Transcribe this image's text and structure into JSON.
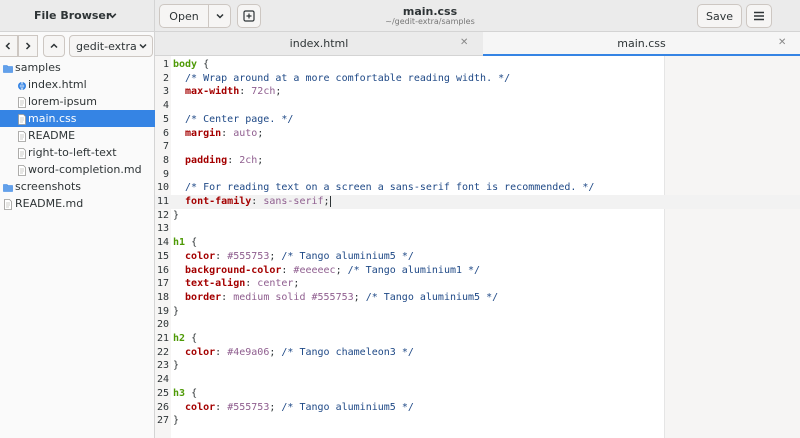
{
  "header": {
    "file_browser_title": "File Browser",
    "open_label": "Open",
    "window_title": "main.css",
    "window_subtitle": "~/gedit-extra/samples",
    "save_label": "Save"
  },
  "sidebar": {
    "folder_selector": "gedit-extra",
    "items": [
      {
        "label": "samples",
        "type": "folder",
        "indent": 0
      },
      {
        "label": "index.html",
        "type": "html-file",
        "indent": 1
      },
      {
        "label": "lorem-ipsum",
        "type": "text-file",
        "indent": 1
      },
      {
        "label": "main.css",
        "type": "css-file",
        "indent": 1,
        "selected": true
      },
      {
        "label": "README",
        "type": "text-file",
        "indent": 1
      },
      {
        "label": "right-to-left-text",
        "type": "text-file",
        "indent": 1
      },
      {
        "label": "word-completion.md",
        "type": "text-file",
        "indent": 1
      },
      {
        "label": "screenshots",
        "type": "folder",
        "indent": 0
      },
      {
        "label": "README.md",
        "type": "text-file",
        "indent": 0
      }
    ]
  },
  "tabs": [
    {
      "label": "index.html",
      "active": false
    },
    {
      "label": "main.css",
      "active": true
    }
  ],
  "editor": {
    "current_line": 11,
    "lines": [
      {
        "n": "1",
        "parts": [
          [
            "sel",
            "body"
          ],
          [
            "punc",
            " {"
          ]
        ]
      },
      {
        "n": "2",
        "parts": [
          [
            "cmt",
            "  /* Wrap around at a more comfortable reading width. */"
          ]
        ]
      },
      {
        "n": "3",
        "parts": [
          [
            "prop",
            "  max-width"
          ],
          [
            "punc",
            ": "
          ],
          [
            "val",
            "72ch"
          ],
          [
            "punc",
            ";"
          ]
        ]
      },
      {
        "n": "4",
        "parts": []
      },
      {
        "n": "5",
        "parts": [
          [
            "cmt",
            "  /* Center page. */"
          ]
        ]
      },
      {
        "n": "6",
        "parts": [
          [
            "prop",
            "  margin"
          ],
          [
            "punc",
            ": "
          ],
          [
            "val",
            "auto"
          ],
          [
            "punc",
            ";"
          ]
        ]
      },
      {
        "n": "7",
        "parts": []
      },
      {
        "n": "8",
        "parts": [
          [
            "prop",
            "  padding"
          ],
          [
            "punc",
            ": "
          ],
          [
            "val",
            "2ch"
          ],
          [
            "punc",
            ";"
          ]
        ]
      },
      {
        "n": "9",
        "parts": []
      },
      {
        "n": "10",
        "parts": [
          [
            "cmt",
            "  /* For reading text on a screen a sans-serif font is recommended. */"
          ]
        ]
      },
      {
        "n": "11",
        "parts": [
          [
            "prop",
            "  font-family"
          ],
          [
            "punc",
            ": "
          ],
          [
            "val",
            "sans-serif"
          ],
          [
            "punc",
            ";"
          ]
        ]
      },
      {
        "n": "12",
        "parts": [
          [
            "punc",
            "}"
          ]
        ]
      },
      {
        "n": "13",
        "parts": []
      },
      {
        "n": "14",
        "parts": [
          [
            "sel",
            "h1"
          ],
          [
            "punc",
            " {"
          ]
        ]
      },
      {
        "n": "15",
        "parts": [
          [
            "prop",
            "  color"
          ],
          [
            "punc",
            ": "
          ],
          [
            "val",
            "#555753"
          ],
          [
            "punc",
            "; "
          ],
          [
            "cmt",
            "/* Tango aluminium5 */"
          ]
        ]
      },
      {
        "n": "16",
        "parts": [
          [
            "prop",
            "  background-color"
          ],
          [
            "punc",
            ": "
          ],
          [
            "val",
            "#eeeeec"
          ],
          [
            "punc",
            "; "
          ],
          [
            "cmt",
            "/* Tango aluminium1 */"
          ]
        ]
      },
      {
        "n": "17",
        "parts": [
          [
            "prop",
            "  text-align"
          ],
          [
            "punc",
            ": "
          ],
          [
            "val",
            "center"
          ],
          [
            "punc",
            ";"
          ]
        ]
      },
      {
        "n": "18",
        "parts": [
          [
            "prop",
            "  border"
          ],
          [
            "punc",
            ": "
          ],
          [
            "val",
            "medium solid #555753"
          ],
          [
            "punc",
            "; "
          ],
          [
            "cmt",
            "/* Tango aluminium5 */"
          ]
        ]
      },
      {
        "n": "19",
        "parts": [
          [
            "punc",
            "}"
          ]
        ]
      },
      {
        "n": "20",
        "parts": []
      },
      {
        "n": "21",
        "parts": [
          [
            "sel",
            "h2"
          ],
          [
            "punc",
            " {"
          ]
        ]
      },
      {
        "n": "22",
        "parts": [
          [
            "prop",
            "  color"
          ],
          [
            "punc",
            ": "
          ],
          [
            "val",
            "#4e9a06"
          ],
          [
            "punc",
            "; "
          ],
          [
            "cmt",
            "/* Tango chameleon3 */"
          ]
        ]
      },
      {
        "n": "23",
        "parts": [
          [
            "punc",
            "}"
          ]
        ]
      },
      {
        "n": "24",
        "parts": []
      },
      {
        "n": "25",
        "parts": [
          [
            "sel",
            "h3"
          ],
          [
            "punc",
            " {"
          ]
        ]
      },
      {
        "n": "26",
        "parts": [
          [
            "prop",
            "  color"
          ],
          [
            "punc",
            ": "
          ],
          [
            "val",
            "#555753"
          ],
          [
            "punc",
            "; "
          ],
          [
            "cmt",
            "/* Tango aluminium5 */"
          ]
        ]
      },
      {
        "n": "27",
        "parts": [
          [
            "punc",
            "}"
          ]
        ]
      }
    ]
  },
  "colors": {
    "accent": "#3584e4",
    "selector": "#4e9a06",
    "property": "#a40000",
    "value": "#8f5e8f",
    "comment": "#204a87"
  }
}
